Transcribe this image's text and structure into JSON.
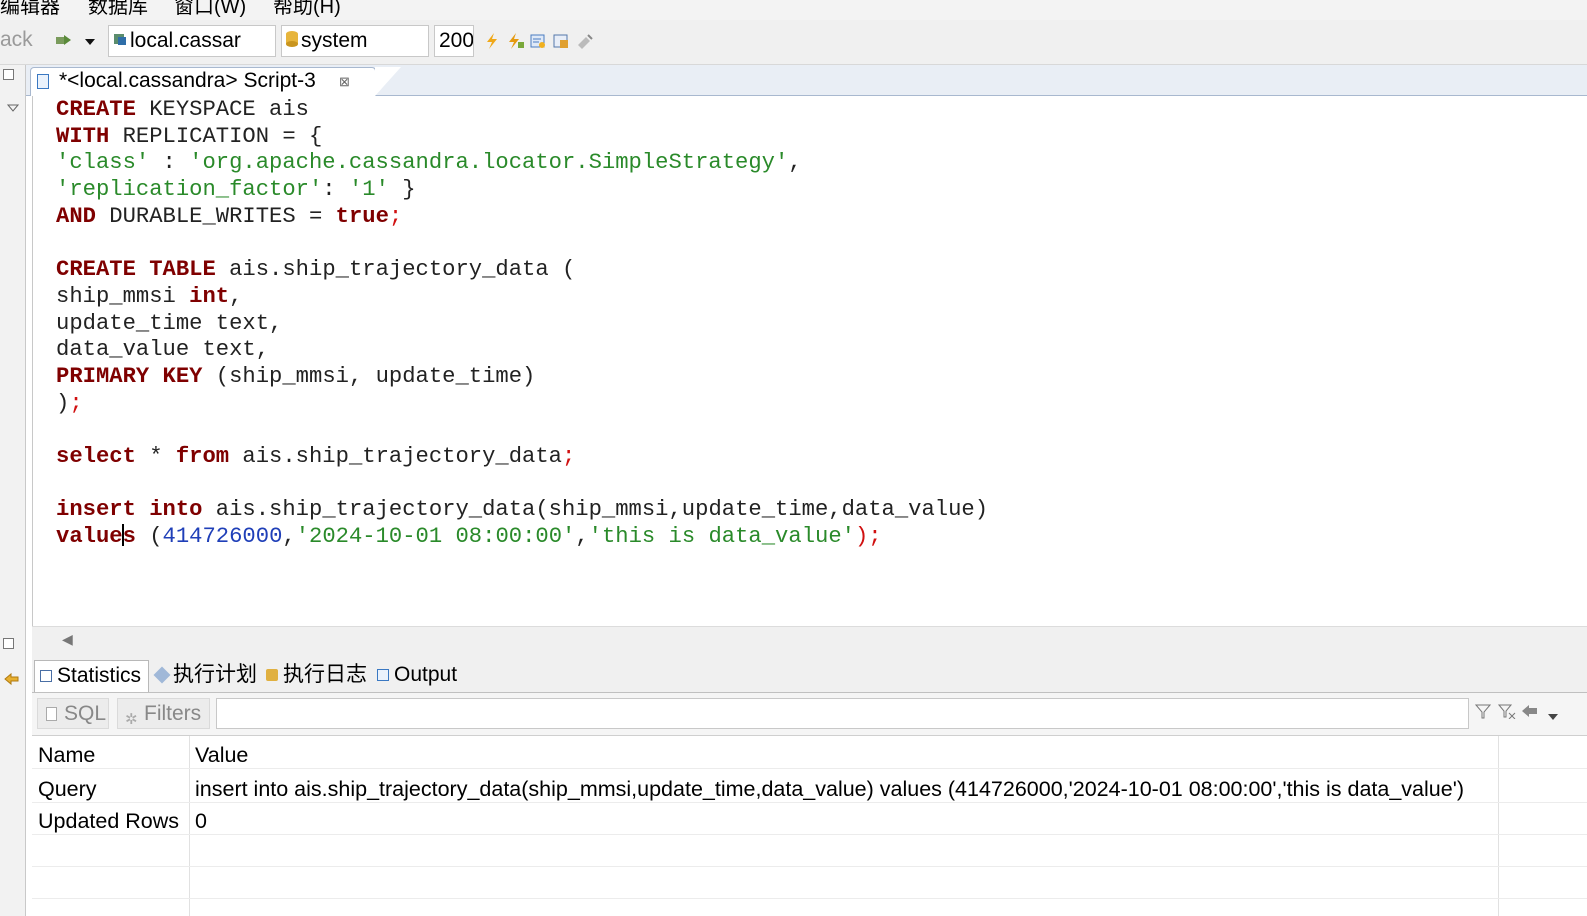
{
  "menu": [
    "编辑器",
    "数据库",
    "窗口(W)",
    "帮助(H)"
  ],
  "toolbar": {
    "back_label": "ack",
    "connection": "local.cassar",
    "schema": "system",
    "limit": "200"
  },
  "editor_tab": {
    "title": "*<local.cassandra> Script-3",
    "close_glyph": "⊠"
  },
  "code_lines": [
    [
      {
        "t": "CREATE",
        "c": "kw"
      },
      {
        "t": " KEYSPACE ais",
        "c": ""
      }
    ],
    [
      {
        "t": "WITH",
        "c": "kw"
      },
      {
        "t": " REPLICATION = {",
        "c": ""
      }
    ],
    [
      {
        "t": "'class'",
        "c": "str"
      },
      {
        "t": " : ",
        "c": ""
      },
      {
        "t": "'org.apache.cassandra.locator.SimpleStrategy'",
        "c": "str"
      },
      {
        "t": ",",
        "c": ""
      }
    ],
    [
      {
        "t": "'replication_factor'",
        "c": "str"
      },
      {
        "t": ": ",
        "c": ""
      },
      {
        "t": "'1'",
        "c": "str"
      },
      {
        "t": " }",
        "c": ""
      }
    ],
    [
      {
        "t": "AND",
        "c": "kw"
      },
      {
        "t": " DURABLE_WRITES = ",
        "c": ""
      },
      {
        "t": "true",
        "c": "kw"
      },
      {
        "t": ";",
        "c": "red"
      }
    ],
    [],
    [
      {
        "t": "CREATE",
        "c": "kw"
      },
      {
        "t": " ",
        "c": ""
      },
      {
        "t": "TABLE",
        "c": "kw"
      },
      {
        "t": " ais.ship_trajectory_data (",
        "c": ""
      }
    ],
    [
      {
        "t": "ship_mmsi ",
        "c": ""
      },
      {
        "t": "int",
        "c": "kw"
      },
      {
        "t": ",",
        "c": ""
      }
    ],
    [
      {
        "t": "update_time text,",
        "c": ""
      }
    ],
    [
      {
        "t": "data_value text,",
        "c": ""
      }
    ],
    [
      {
        "t": "PRIMARY",
        "c": "kw"
      },
      {
        "t": " ",
        "c": ""
      },
      {
        "t": "KEY",
        "c": "kw"
      },
      {
        "t": " (ship_mmsi, update_time)",
        "c": ""
      }
    ],
    [
      {
        "t": ")",
        "c": ""
      },
      {
        "t": ";",
        "c": "red"
      }
    ],
    [],
    [
      {
        "t": "select",
        "c": "kw"
      },
      {
        "t": " * ",
        "c": ""
      },
      {
        "t": "from",
        "c": "kw"
      },
      {
        "t": " ais.ship_trajectory_data",
        "c": ""
      },
      {
        "t": ";",
        "c": "red"
      }
    ],
    [],
    [
      {
        "t": "insert",
        "c": "kw"
      },
      {
        "t": " ",
        "c": ""
      },
      {
        "t": "into",
        "c": "kw"
      },
      {
        "t": " ais.ship_trajectory_data(ship_mmsi,update_time,data_value)",
        "c": ""
      }
    ],
    [
      {
        "t": "value",
        "c": "kw"
      },
      {
        "t": "|",
        "c": "caret"
      },
      {
        "t": "s",
        "c": "kw"
      },
      {
        "t": " (",
        "c": ""
      },
      {
        "t": "414726000",
        "c": "num"
      },
      {
        "t": ",",
        "c": ""
      },
      {
        "t": "'2024-10-01 08:00:00'",
        "c": "str"
      },
      {
        "t": ",",
        "c": ""
      },
      {
        "t": "'this is data_value'",
        "c": "str"
      },
      {
        "t": ");",
        "c": "red"
      }
    ]
  ],
  "result_tabs": [
    "Statistics",
    "执行计划",
    "执行日志",
    "Output"
  ],
  "filter": {
    "sql_label": "SQL",
    "filters_label": "Filters",
    "value": ""
  },
  "stats": {
    "headers": [
      "Name",
      "Value"
    ],
    "rows": [
      [
        "Query",
        "insert into ais.ship_trajectory_data(ship_mmsi,update_time,data_value) values (414726000,'2024-10-01 08:00:00','this is data_value')"
      ],
      [
        "Updated Rows",
        "0"
      ]
    ]
  }
}
